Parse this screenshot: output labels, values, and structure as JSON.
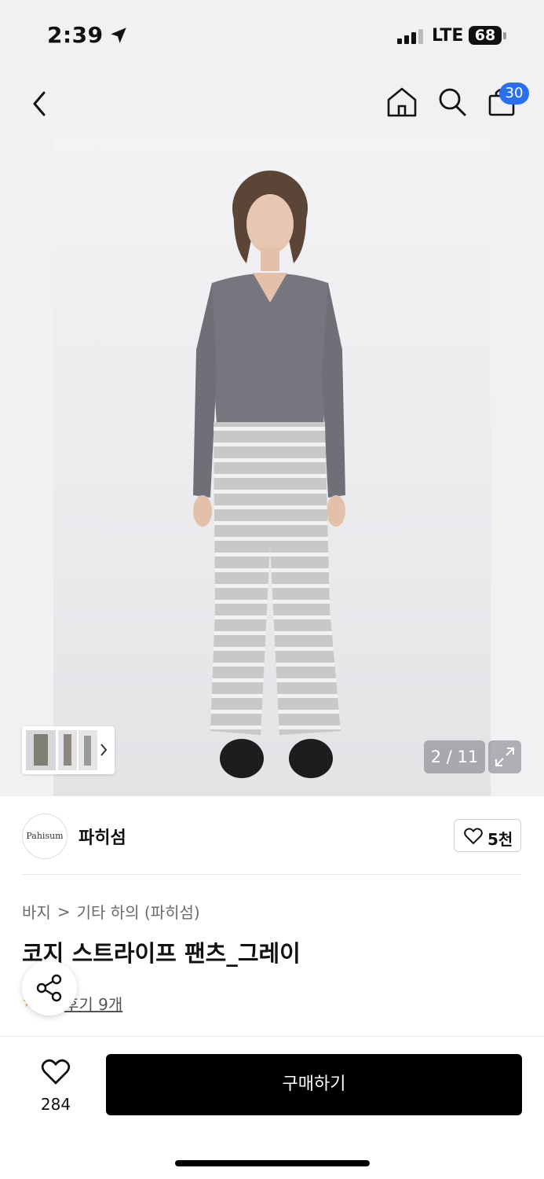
{
  "status_bar": {
    "time": "2:39",
    "network": "LTE",
    "battery": "68"
  },
  "nav": {
    "cart_count": "30"
  },
  "gallery": {
    "page_counter": "2 / 11"
  },
  "brand": {
    "logo_text": "Pahisum",
    "name": "파히섬",
    "likes": "5천"
  },
  "breadcrumb": {
    "category": "바지",
    "separator": ">",
    "subcategory": "기타 하의 (파히섬)"
  },
  "product": {
    "title": "코지 스트라이프 팬츠_그레이",
    "review_link": "후기 9개"
  },
  "bottom_bar": {
    "wish_count": "284",
    "buy_label": "구매하기"
  },
  "colors": {
    "accent_badge": "#2a6ff0",
    "buy_button": "#000000",
    "review_star": "#f5a623"
  }
}
